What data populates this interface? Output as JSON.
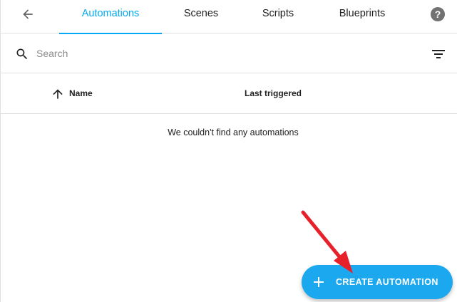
{
  "header": {
    "back_icon": "arrow-left-icon",
    "tabs": [
      {
        "label": "Automations",
        "active": true
      },
      {
        "label": "Scenes",
        "active": false
      },
      {
        "label": "Scripts",
        "active": false
      },
      {
        "label": "Blueprints",
        "active": false
      }
    ],
    "help_icon": "help-circle-icon",
    "help_glyph": "?"
  },
  "search": {
    "placeholder": "Search",
    "value": "",
    "icon": "search-icon",
    "filter_icon": "filter-icon"
  },
  "table": {
    "columns": [
      {
        "label": "Name",
        "sort": "ascending",
        "sort_icon": "arrow-up-icon"
      },
      {
        "label": "Last triggered"
      }
    ],
    "empty_message": "We couldn't find any automations"
  },
  "fab": {
    "label": "CREATE AUTOMATION",
    "icon": "plus-icon"
  },
  "colors": {
    "accent": "#03a9f4",
    "fab_background": "#1ca8ef",
    "annotation_arrow": "#e8202a"
  }
}
